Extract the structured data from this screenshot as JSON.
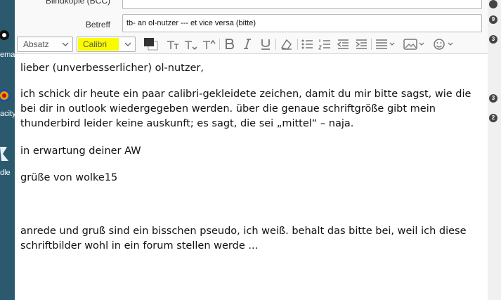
{
  "desktop": {
    "left_labels": [
      "ema",
      "acity",
      "dle"
    ],
    "right_badges": [
      "9",
      "3",
      "3",
      "2"
    ]
  },
  "header": {
    "bcc_label": "Blindkopie (BCC)",
    "bcc_value": "",
    "subject_label": "Betreff",
    "subject_value": "tb- an ol-nutzer --- et vice versa (bitte)"
  },
  "toolbar": {
    "paragraph_format": "Absatz",
    "font_family": "Calibri",
    "font_highlight_color": "#fbfb00",
    "text_color": "#333333",
    "background_color": "#ffffff"
  },
  "body": {
    "greeting": "lieber (unverbesserlicher) ol-nutzer,",
    "paragraph1": "ich schick dir heute ein paar calibri-gekleidete zeichen, damit du mir bitte sagst, wie die bei dir in outlook wiedergegeben werden. über die genaue schriftgröße gibt mein thunderbird leider keine auskunft; es sagt, die sei „mittel“ – naja.",
    "paragraph2": "in erwartung deiner AW",
    "closing": "grüße von wolke15",
    "postscript": "anrede und gruß sind ein bisschen pseudo, ich weiß. behalt das bitte bei, weil ich diese schriftbilder wohl in ein forum stellen werde ..."
  }
}
